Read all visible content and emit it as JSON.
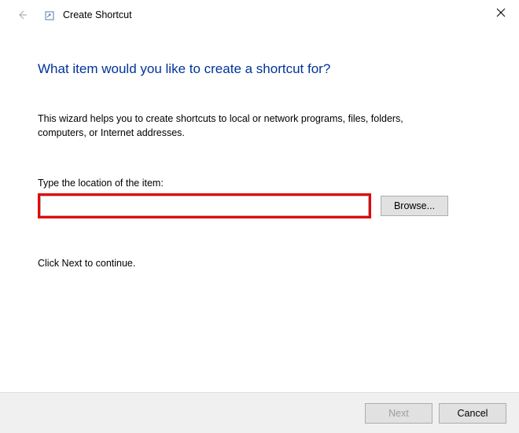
{
  "titlebar": {
    "title": "Create Shortcut"
  },
  "content": {
    "heading": "What item would you like to create a shortcut for?",
    "description": "This wizard helps you to create shortcuts to local or network programs, files, folders, computers, or Internet addresses.",
    "field_label": "Type the location of the item:",
    "location_value": "",
    "browse_label": "Browse...",
    "continue_text": "Click Next to continue."
  },
  "footer": {
    "next_label": "Next",
    "cancel_label": "Cancel"
  }
}
